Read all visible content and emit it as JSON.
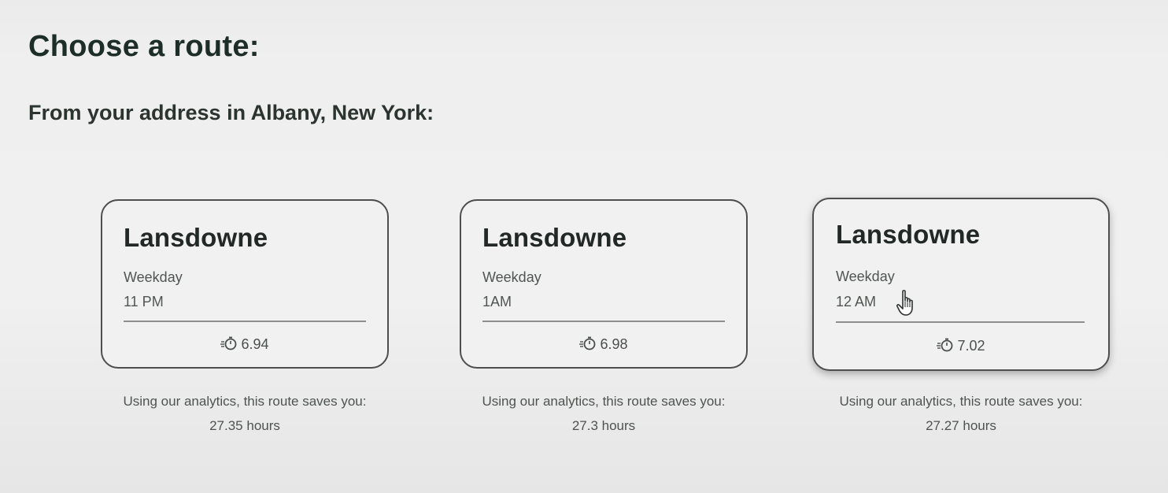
{
  "header": {
    "title": "Choose a route:",
    "subtitle": "From your address in Albany, New York:"
  },
  "routes": [
    {
      "name": "Lansdowne",
      "day": "Weekday",
      "time": "11 PM",
      "score": "6.94",
      "caption": "Using our analytics, this route saves you:",
      "savings": "27.35 hours"
    },
    {
      "name": "Lansdowne",
      "day": "Weekday",
      "time": "1AM",
      "score": "6.98",
      "caption": "Using our analytics, this route saves you:",
      "savings": "27.3 hours"
    },
    {
      "name": "Lansdowne",
      "day": "Weekday",
      "time": "12 AM",
      "score": "7.02",
      "caption": "Using our analytics, this route saves you:",
      "savings": "27.27 hours"
    }
  ],
  "icons": {
    "score": "stopwatch-icon",
    "pointer": "hand-pointer-icon"
  },
  "colors": {
    "heading": "#1d2e28",
    "card_border": "#4d4f4e",
    "muted_text": "#505552"
  }
}
